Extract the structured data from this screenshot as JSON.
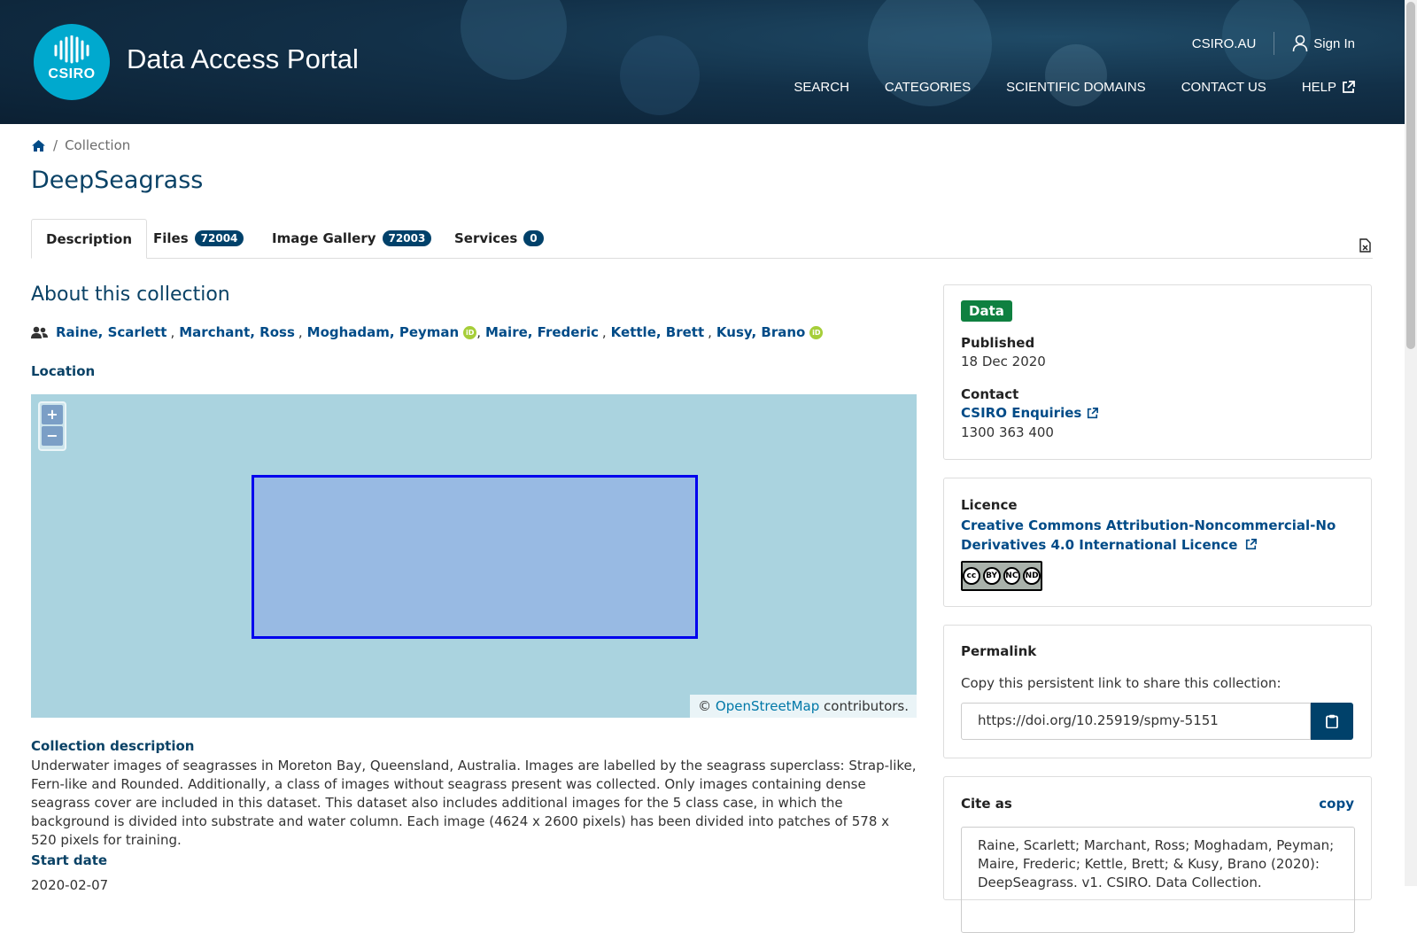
{
  "header": {
    "brand_logo_text": "CSIRO",
    "brand_title": "Data Access Portal",
    "top_links": {
      "csiro": "CSIRO.AU",
      "sign_in": "Sign In"
    },
    "nav": {
      "search": "SEARCH",
      "categories": "CATEGORIES",
      "scientific_domains": "SCIENTIFIC DOMAINS",
      "contact_us": "CONTACT US",
      "help": "HELP"
    }
  },
  "breadcrumb": {
    "home_icon": "home-icon",
    "current": "Collection"
  },
  "page_title": "DeepSeagrass",
  "tabs": [
    {
      "label": "Description"
    },
    {
      "label": "Files",
      "count": "72004"
    },
    {
      "label": "Image Gallery",
      "count": "72003"
    },
    {
      "label": "Services",
      "count": "0"
    }
  ],
  "about": {
    "title": "About this collection",
    "authors": [
      {
        "name": "Raine, Scarlett"
      },
      {
        "name": "Marchant, Ross"
      },
      {
        "name": "Moghadam, Peyman",
        "orcid": true
      },
      {
        "name": "Maire, Frederic"
      },
      {
        "name": "Kettle, Brett"
      },
      {
        "name": "Kusy, Brano",
        "orcid": true
      }
    ],
    "location_label": "Location",
    "map": {
      "zoom_in": "+",
      "zoom_out": "−",
      "attribution_prefix": "©",
      "attribution_link": "OpenStreetMap",
      "attribution_suffix": "contributors."
    },
    "description_label": "Collection description",
    "description": "Underwater images of seagrasses in Moreton Bay, Queensland, Australia. Images are labelled by the seagrass superclass: Strap-like, Fern-like and Rounded. Additionally, a class of images without seagrass present was collected. Only images containing dense seagrass cover are included in this dataset. This dataset also includes additional images for the 5 class case, in which the background is divided into substrate and water column. Each image (4624 x 2600 pixels) has been divided into patches of 578 x 520 pixels for training.",
    "start_date_label": "Start date",
    "start_date": "2020-02-07"
  },
  "sidebar": {
    "type_badge": "Data",
    "published_label": "Published",
    "published": "18 Dec 2020",
    "contact_label": "Contact",
    "contact_name": "CSIRO Enquiries",
    "contact_phone": "1300 363 400",
    "licence_label": "Licence",
    "licence_name": "Creative Commons Attribution-Noncommercial-No Derivatives 4.0 International Licence",
    "cc_badge": {
      "by": "BY",
      "nc": "NC",
      "nd": "ND"
    },
    "permalink_label": "Permalink",
    "permalink_help": "Copy this persistent link to share this collection:",
    "permalink_url": "https://doi.org/10.25919/spmy-5151",
    "cite_label": "Cite as",
    "cite_copy": "copy",
    "citation": "Raine, Scarlett; Marchant, Ross; Moghadam, Peyman; Maire, Frederic; Kettle, Brett; & Kusy, Brano (2020): DeepSeagrass. v1. CSIRO. Data Collection."
  },
  "colors": {
    "brand_blue": "#00416a",
    "link_blue": "#004b87",
    "heading_blue": "#0a4266",
    "data_badge_green": "#0f8040",
    "map_water": "#aad3df",
    "bbox_stroke": "#0000ee",
    "orcid_green": "#a6ce39"
  }
}
